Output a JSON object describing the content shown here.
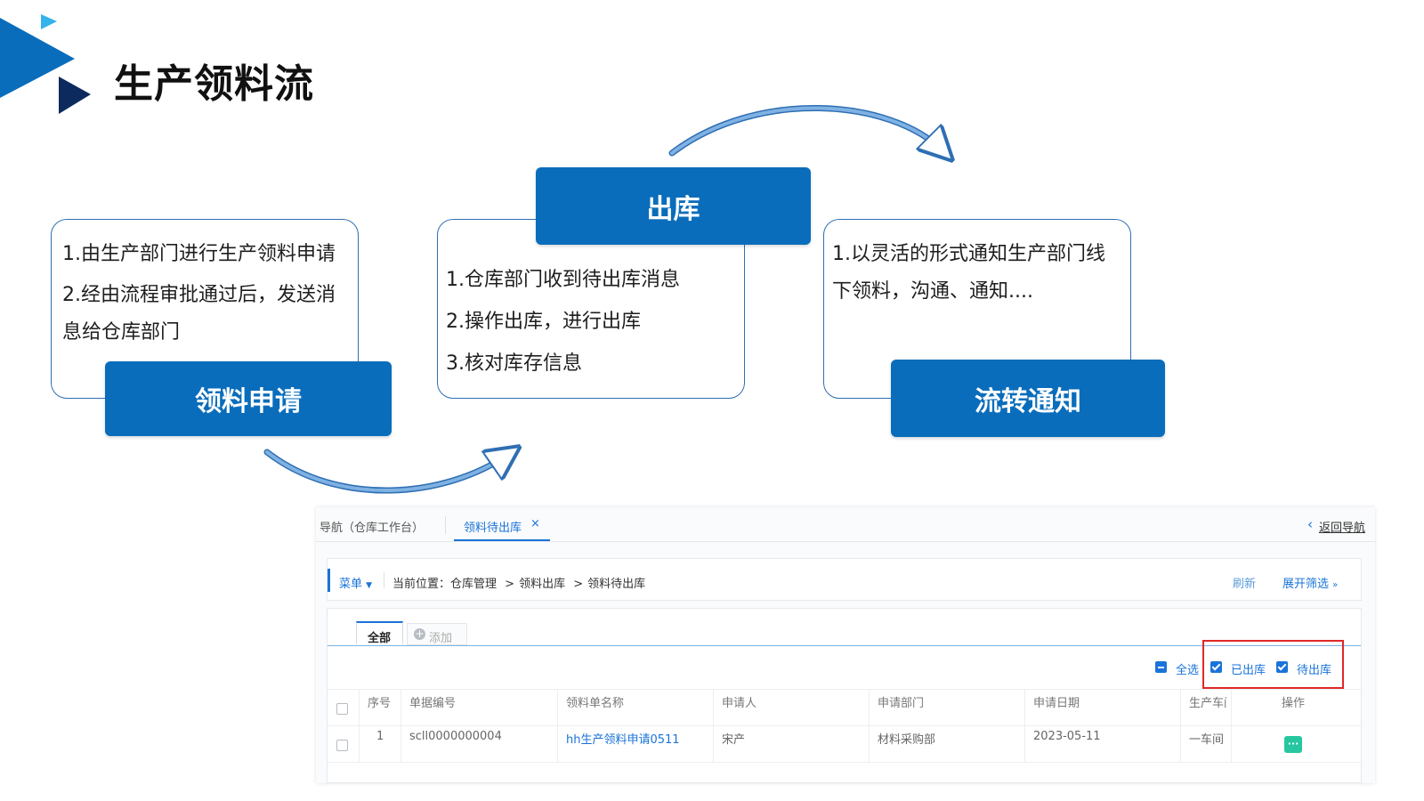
{
  "slide": {
    "title": "生产领料流"
  },
  "flow": {
    "step1": {
      "label": "领料申请",
      "lines": [
        "1.由生产部门进行生产领料申请",
        "2.经由流程审批通过后，发送消",
        "息给仓库部门"
      ]
    },
    "step2": {
      "label": "出库",
      "lines": [
        "1.仓库部门收到待出库消息",
        "2.操作出库，进行出库",
        "3.核对库存信息"
      ]
    },
    "step3": {
      "label": "流转通知",
      "lines": [
        "1.以灵活的形式通知生产部门线",
        "下领料，沟通、通知...."
      ]
    }
  },
  "ui": {
    "nav_tab": "导航（仓库工作台）",
    "active_tab": "领料待出库",
    "active_tab_close": "×",
    "back_nav": "返回导航",
    "menu": "菜单",
    "location_prefix": "当前位置：",
    "breadcrumb": [
      "仓库管理",
      "领料出库",
      "领料待出库"
    ],
    "breadcrumb_sep": ">",
    "refresh": "刷新",
    "expand_filter": "展开筛选",
    "sub_tabs": [
      "全部",
      "添加"
    ],
    "filters": {
      "select_all": "全选",
      "shipped": "已出库",
      "pending": "待出库"
    },
    "table": {
      "columns": [
        "序号",
        "单据编号",
        "领料单名称",
        "申请人",
        "申请部门",
        "申请日期",
        "生产车间",
        "操作"
      ],
      "rows": [
        {
          "index": "1",
          "doc_no": "scll0000000004",
          "name": "hh生产领料申请0511",
          "applicant": "宋产",
          "dept": "材料采购部",
          "date": "2023-05-11",
          "workshop": "一车间",
          "action": "···"
        }
      ]
    }
  },
  "colors": {
    "brand_blue": "#0a6dbb",
    "arrow_blue": "#4f8fd0",
    "highlight_red": "#e02828",
    "link_blue": "#1a73d9",
    "action_green": "#26c6a0"
  }
}
